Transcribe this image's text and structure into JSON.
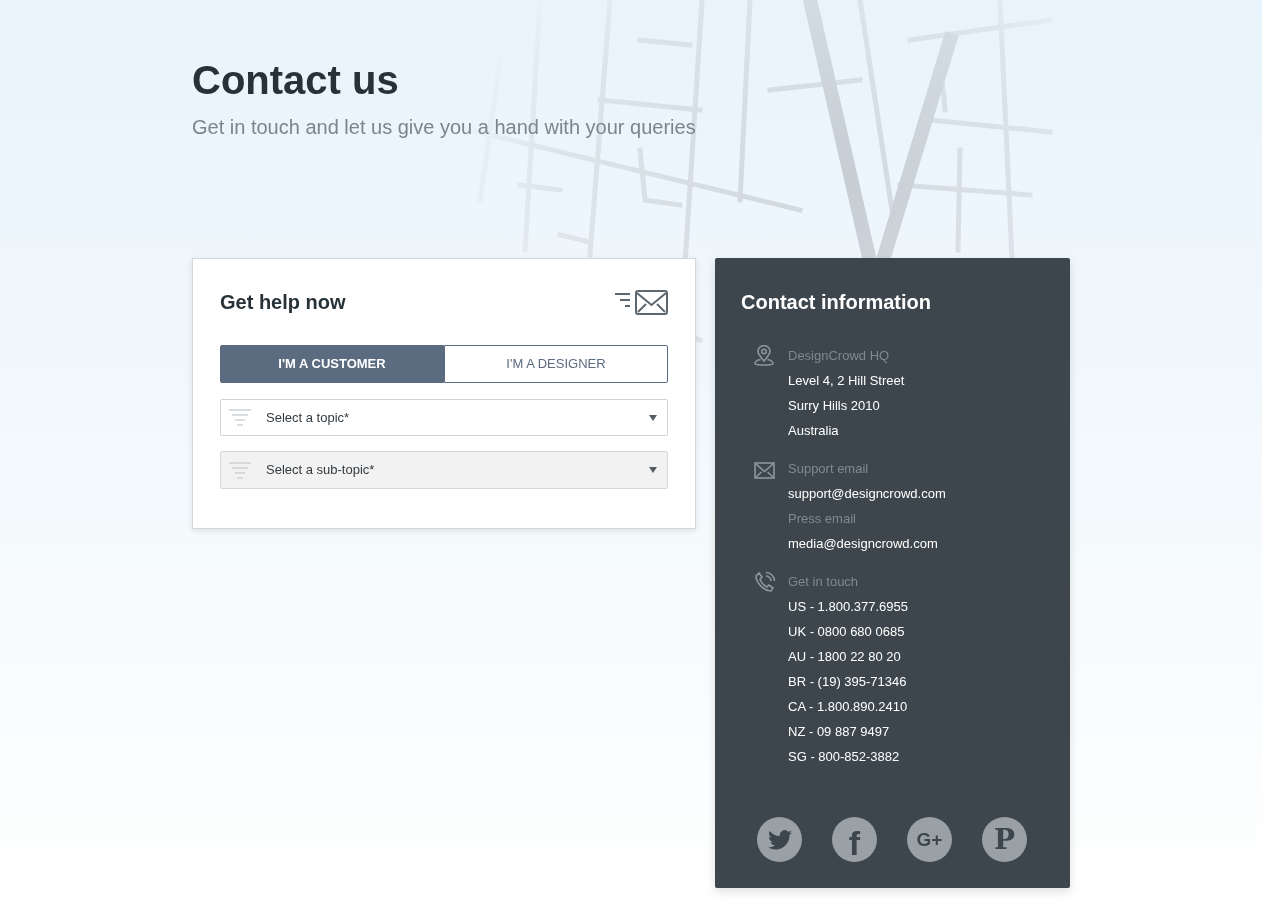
{
  "header": {
    "title": "Contact us",
    "subtitle": "Get in touch and let us give you a hand with your queries"
  },
  "help_form": {
    "title": "Get help now",
    "tabs": [
      {
        "label": "I'M A CUSTOMER",
        "selected": true
      },
      {
        "label": "I'M A DESIGNER",
        "selected": false
      }
    ],
    "selects": [
      {
        "placeholder": "Select a topic*",
        "disabled": false
      },
      {
        "placeholder": "Select a sub-topic*",
        "disabled": true
      }
    ]
  },
  "contact_info": {
    "title": "Contact information",
    "sections": [
      {
        "kind": "address",
        "entries": [
          {
            "label": "DesignCrowd HQ",
            "lines": [
              "Level 4, 2 Hill Street",
              "Surry Hills 2010",
              "Australia"
            ]
          }
        ]
      },
      {
        "kind": "email",
        "entries": [
          {
            "label": "Support email",
            "lines": [
              "support@designcrowd.com"
            ]
          },
          {
            "label": "Press email",
            "lines": [
              "media@designcrowd.com"
            ]
          }
        ]
      },
      {
        "kind": "phone",
        "entries": [
          {
            "label": "Get in touch",
            "lines": [
              "US - 1.800.377.6955",
              "UK - 0800 680 0685",
              "AU - 1800 22 80 20",
              "BR - (19) 395-71346",
              "CA - 1.800.890.2410",
              "NZ - 09 887 9497",
              "SG - 800-852-3882"
            ]
          }
        ]
      }
    ],
    "social_links": [
      {
        "kind": "twitter"
      },
      {
        "kind": "facebook",
        "glyph": "f"
      },
      {
        "kind": "google_plus",
        "glyph": "G+"
      },
      {
        "kind": "pinterest",
        "glyph": "P"
      }
    ]
  }
}
